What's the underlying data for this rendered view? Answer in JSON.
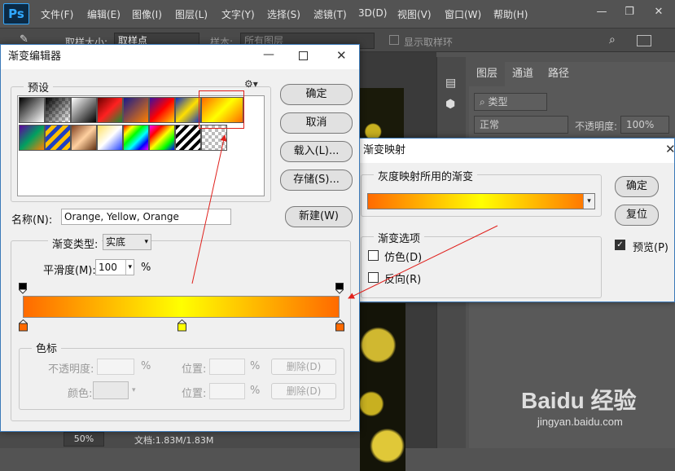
{
  "photoshop": {
    "logo": "Ps",
    "menu": [
      "文件(F)",
      "编辑(E)",
      "图像(I)",
      "图层(L)",
      "文字(Y)",
      "选择(S)",
      "滤镜(T)",
      "3D(D)",
      "视图(V)",
      "窗口(W)",
      "帮助(H)"
    ],
    "window_controls": {
      "minimize": "—",
      "restore": "❐",
      "close": "✕"
    },
    "options_bar": {
      "sample_size_label": "取样大小:",
      "sample_size_value": "取样点",
      "sample_label": "样本:",
      "sample_value": "所有图层",
      "show_ring_label": "显示取样环"
    },
    "layers_panel": {
      "tabs": [
        "图层",
        "通道",
        "路径"
      ],
      "filter_value": "类型",
      "blend_mode": "正常",
      "opacity_label": "不透明度:",
      "opacity_value": "100%"
    },
    "status_bar": {
      "zoom": "50%",
      "doc_info": "文档:1.83M/1.83M"
    },
    "watermark": {
      "brand": "Baidu 经验",
      "url": "jingyan.baidu.com"
    }
  },
  "gradient_editor": {
    "title": "渐变编辑器",
    "presets_label": "预设",
    "ok_label": "确定",
    "cancel_label": "取消",
    "load_label": "载入(L)...",
    "save_label": "存储(S)...",
    "name_label": "名称(N):",
    "name_value": "Orange, Yellow, Orange",
    "new_label": "新建(W)",
    "gradient_type_label": "渐变类型:",
    "gradient_type_value": "实底",
    "smoothness_label": "平滑度(M):",
    "smoothness_value": "100",
    "smoothness_unit": "%",
    "stops_group_label": "色标",
    "opacity_label": "不透明度:",
    "opacity_unit": "%",
    "location_label": "位置:",
    "location_unit": "%",
    "delete_label": "删除(D)",
    "color_label": "颜色:",
    "location2_label": "位置:",
    "location2_unit": "%",
    "delete2_label": "删除(D)",
    "gradient_colors": {
      "start": "#ff6a00",
      "mid": "#ffff00",
      "end": "#ff6a00"
    },
    "color_stops_pct": [
      0,
      50,
      100
    ],
    "opacity_stops_pct": [
      0,
      100
    ],
    "selected_preset_index": 7
  },
  "gradient_map": {
    "title": "渐变映射",
    "group_label": "灰度映射所用的渐变",
    "ok_label": "确定",
    "reset_label": "复位",
    "options_label": "渐变选项",
    "dither_label": "仿色(D)",
    "dither_checked": false,
    "reverse_label": "反向(R)",
    "reverse_checked": false,
    "preview_label": "预览(P)",
    "preview_checked": true
  },
  "annotation_color": "#e0201c"
}
